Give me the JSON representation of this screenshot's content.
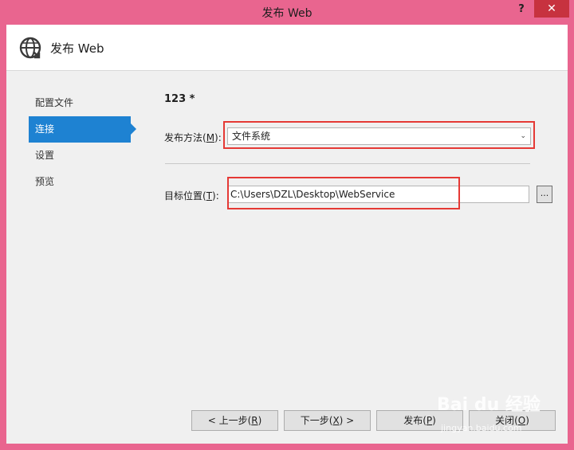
{
  "window": {
    "title": "发布 Web",
    "help_label": "?",
    "close_label": "✕"
  },
  "header": {
    "title": "发布 Web",
    "icon": "globe-icon"
  },
  "sidebar": {
    "items": [
      {
        "label": "配置文件",
        "active": false
      },
      {
        "label": "连接",
        "active": true
      },
      {
        "label": "设置",
        "active": false
      },
      {
        "label": "预览",
        "active": false
      }
    ]
  },
  "main": {
    "profile_name": "123 *",
    "publish_method": {
      "label_prefix": "发布方法(",
      "label_key": "M",
      "label_suffix": "):",
      "value": "文件系统"
    },
    "target_location": {
      "label_prefix": "目标位置(",
      "label_key": "T",
      "label_suffix": "):",
      "value": "C:\\Users\\DZL\\Desktop\\WebService",
      "browse_label": "..."
    }
  },
  "footer": {
    "prev": {
      "prefix": "< 上一步(",
      "key": "R",
      "suffix": ")"
    },
    "next": {
      "prefix": "下一步(",
      "key": "X",
      "suffix": ") >"
    },
    "publish": {
      "prefix": "发布(",
      "key": "P",
      "suffix": ")"
    },
    "close": {
      "prefix": "关闭(",
      "key": "O",
      "suffix": ")"
    }
  },
  "watermark": {
    "text": "Bai du 经验",
    "sub": "jingyan.baidu.com"
  },
  "colors": {
    "window_frame": "#e9658f",
    "accent": "#1e82d2",
    "highlight": "#e53935"
  }
}
